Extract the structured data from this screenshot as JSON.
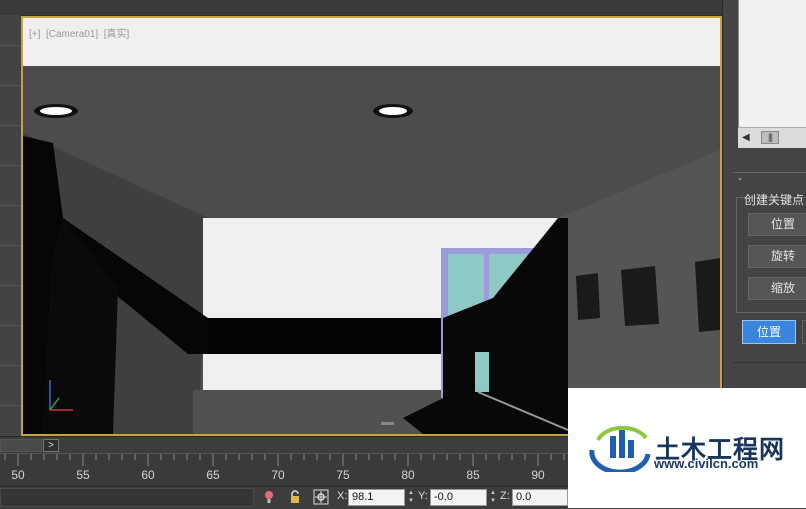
{
  "viewport": {
    "label": "[+]  [Camera01]  [真实]"
  },
  "right_panel": {
    "group_title": "创建关键点",
    "collapse_symbol": "-",
    "buttons": [
      "位置",
      "旋转",
      "缩放"
    ],
    "active_button": "位置"
  },
  "timeline": {
    "next_symbol": ">",
    "ruler_labels": [
      "50",
      "55",
      "60",
      "65",
      "70",
      "75",
      "80",
      "85",
      "90"
    ]
  },
  "status": {
    "x_label": "X:",
    "x_value": "98.1",
    "y_label": "Y:",
    "y_value": "-0.0",
    "z_label": "Z:",
    "z_value": "0.0"
  },
  "watermark": {
    "title": "土木工程网",
    "url": "www.civilcn.com"
  },
  "icons": [
    "lightbulb-icon",
    "lock-icon",
    "crosshair-icon",
    "logo-icon",
    "axis-gizmo-icon"
  ],
  "colors": {
    "viewport_border": "#c8a23d",
    "active_button": "#3a86df",
    "watermark_text": "#16365e"
  }
}
